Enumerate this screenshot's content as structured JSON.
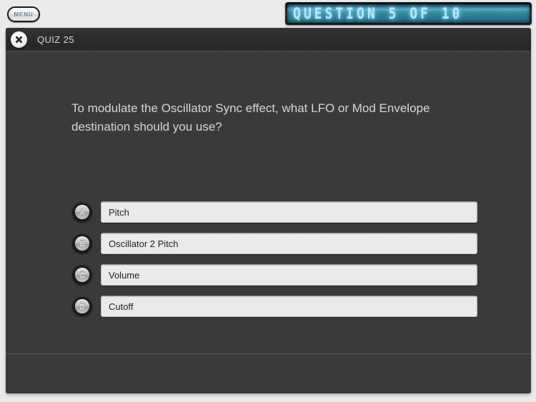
{
  "topbar": {
    "menu_label": "MENU",
    "counter_display": "QUESTION 5 OF 10",
    "lcd_color": "#b7e8f7",
    "lcd_background": "#2f7e99"
  },
  "header": {
    "close_icon": "close-icon",
    "title": "QUIZ 25"
  },
  "quiz": {
    "question": "To modulate the Oscillator Sync effect, what LFO or Mod Envelope destination should you use?",
    "options": [
      {
        "letter": "A",
        "text": "Pitch"
      },
      {
        "letter": "B",
        "text": "Oscillator 2 Pitch"
      },
      {
        "letter": "C",
        "text": "Volume"
      },
      {
        "letter": "D",
        "text": "Cutoff"
      }
    ]
  },
  "theme": {
    "page_background": "#eaeaea",
    "panel_background": "#3a3a3a",
    "header_background": "#2b2b2b",
    "answer_background": "#e9e9e9",
    "text_light": "#d6d6d6"
  }
}
